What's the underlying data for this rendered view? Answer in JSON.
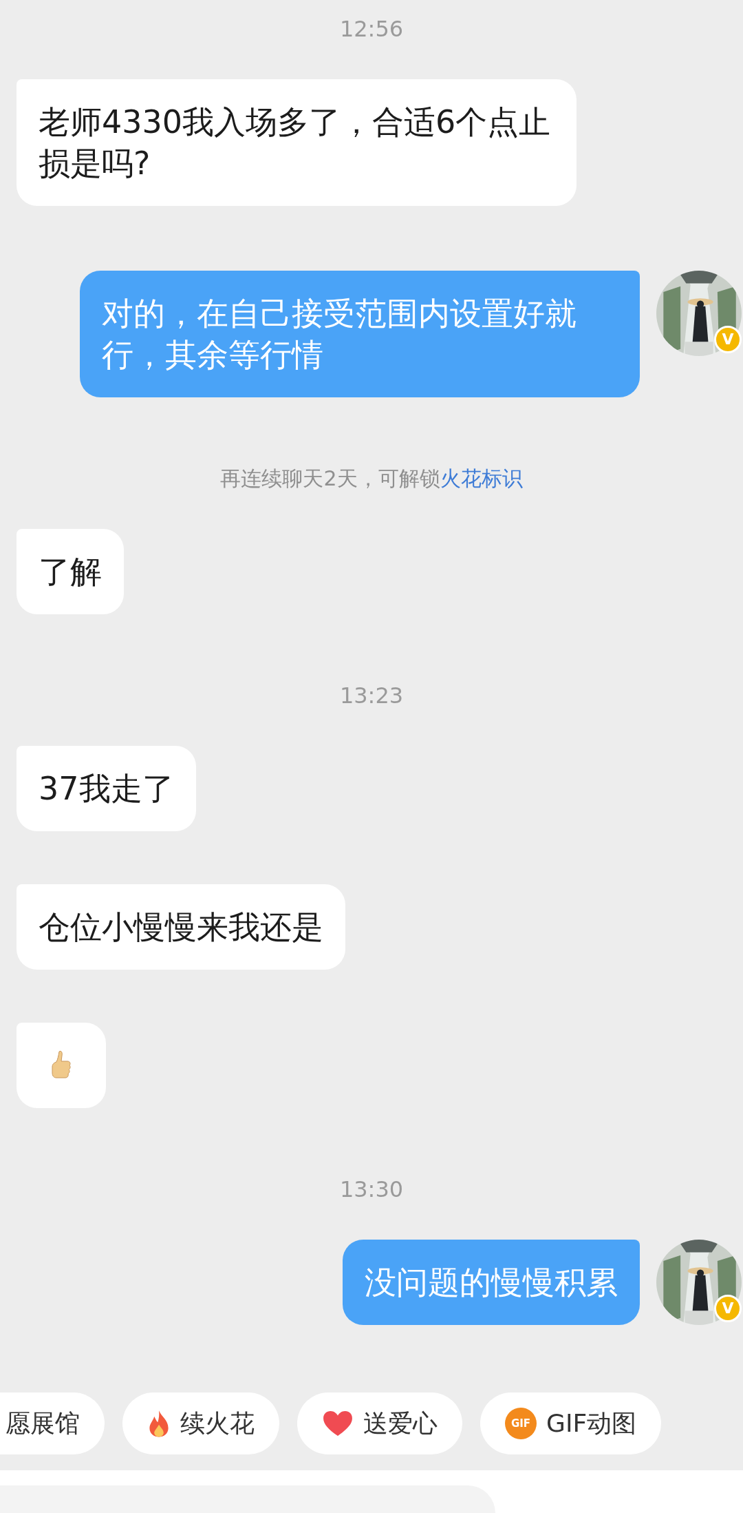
{
  "messages": [
    {
      "kind": "time",
      "text": "12:56"
    },
    {
      "kind": "in",
      "text": "老师4330我入场多了，合适6个点止损是吗?"
    },
    {
      "kind": "out",
      "text": "对的，在自己接受范围内设置好就行，其余等行情",
      "avatar": {
        "kind": "picture",
        "badge": "V"
      }
    },
    {
      "kind": "notice",
      "text": "再连续聊天2天，可解锁",
      "link": "火花标识"
    },
    {
      "kind": "in",
      "text": "了解"
    },
    {
      "kind": "time",
      "text": "13:23"
    },
    {
      "kind": "in",
      "text": "37我走了"
    },
    {
      "kind": "in",
      "text": "仓位小慢慢来我还是"
    },
    {
      "kind": "thumb"
    },
    {
      "kind": "time",
      "text": "13:30"
    },
    {
      "kind": "out",
      "text": "没问题的慢慢积累",
      "avatar": {
        "kind": "picture",
        "badge": "V"
      }
    }
  ],
  "chips": [
    {
      "label": "愿展馆"
    },
    {
      "label": "续火花",
      "kind": "flame"
    },
    {
      "label": "送爱心",
      "kind": "heart"
    },
    {
      "label": "GIF动图",
      "kind": "gif",
      "icon_text": "GIF"
    }
  ]
}
